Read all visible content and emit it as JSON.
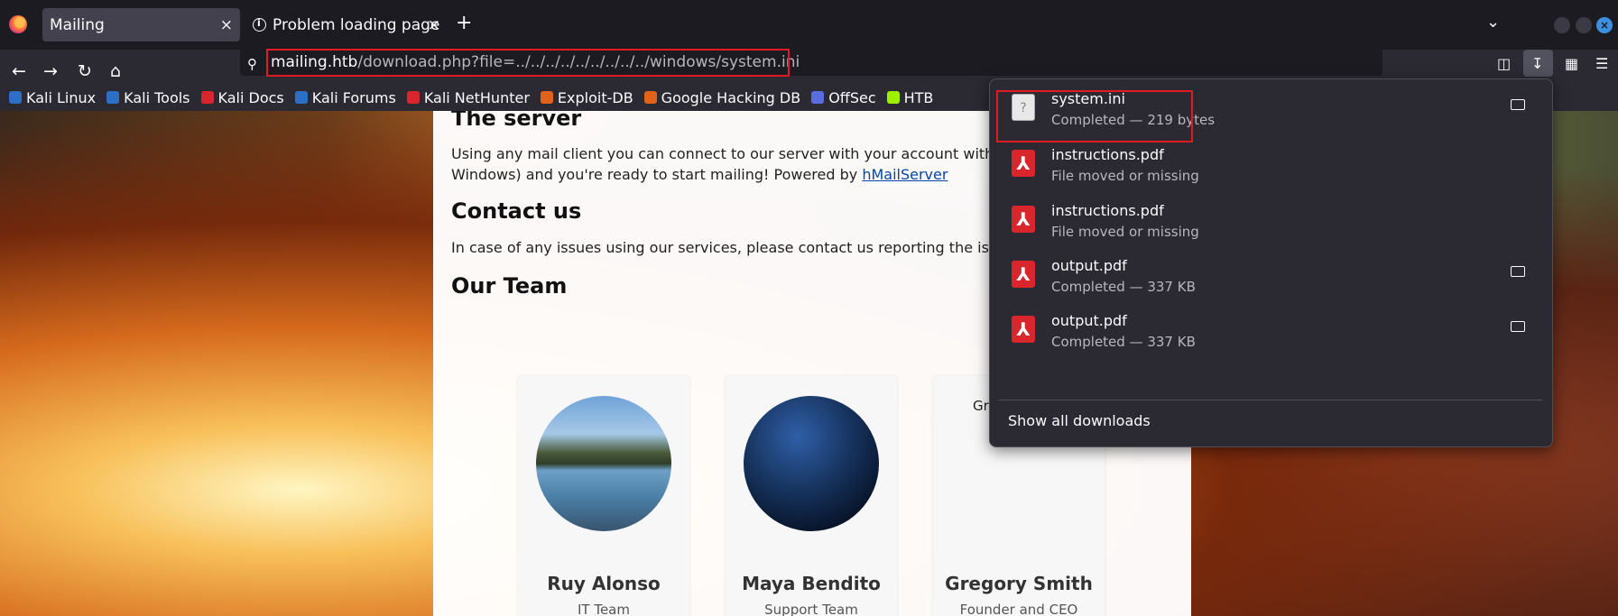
{
  "tabs": [
    {
      "label": "Mailing",
      "close": "×"
    },
    {
      "label": "Problem loading page",
      "close": "×"
    }
  ],
  "new_tab": "+",
  "tab_list": "⌄",
  "nav": {
    "back": "←",
    "forward": "→",
    "reload": "↻",
    "home": "⌂"
  },
  "url": {
    "host": "mailing.htb",
    "path": "/download.php?file=../../../../../../../../../windows/system.ini"
  },
  "bookmarks": [
    {
      "label": "Kali Linux",
      "color": "#2d6fc4"
    },
    {
      "label": "Kali Tools",
      "color": "#2d6fc4"
    },
    {
      "label": "Kali Docs",
      "color": "#d8262c"
    },
    {
      "label": "Kali Forums",
      "color": "#2d6fc4"
    },
    {
      "label": "Kali NetHunter",
      "color": "#d8262c"
    },
    {
      "label": "Exploit-DB",
      "color": "#e0631c"
    },
    {
      "label": "Google Hacking DB",
      "color": "#e0631c"
    },
    {
      "label": "OffSec",
      "color": "#5b6be0"
    },
    {
      "label": "HTB",
      "color": "#9fef00"
    }
  ],
  "page": {
    "server_heading": "The server",
    "server_text_1": "Using any mail client you can connect to our server with your account with any s",
    "server_text_2": "Windows) and you're ready to start mailing! Powered by ",
    "server_link": "hMailServer",
    "contact_heading": "Contact us",
    "contact_text": "In case of any issues using our services, please contact us reporting the issue",
    "team_heading": "Our Team",
    "team": [
      {
        "name": "Ruy Alonso",
        "role": "IT Team"
      },
      {
        "name": "Maya Bendito",
        "role": "Support Team"
      },
      {
        "name": "Gregory Smith",
        "role": "Founder and CEO",
        "image_text": "Gr"
      }
    ]
  },
  "downloads": {
    "items": [
      {
        "name": "system.ini",
        "status": "Completed — 219 bytes",
        "icon": "text-file-icon",
        "folder": true
      },
      {
        "name": "instructions.pdf",
        "status": "File moved or missing",
        "icon": "pdf-icon",
        "folder": false
      },
      {
        "name": "instructions.pdf",
        "status": "File moved or missing",
        "icon": "pdf-icon",
        "folder": false
      },
      {
        "name": "output.pdf",
        "status": "Completed — 337 KB",
        "icon": "pdf-icon",
        "folder": true
      },
      {
        "name": "output.pdf",
        "status": "Completed — 337 KB",
        "icon": "pdf-icon",
        "folder": true
      }
    ],
    "show_all": "Show all downloads"
  },
  "colors": {
    "highlight": "#e01b24",
    "panel_bg": "#2b2a33",
    "link": "#0645ad"
  }
}
